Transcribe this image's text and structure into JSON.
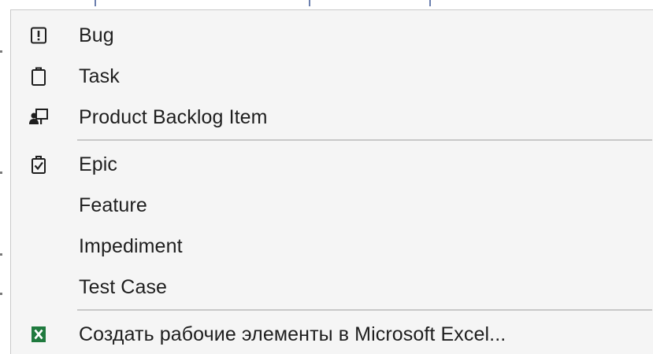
{
  "menu": {
    "items": [
      {
        "label": "Bug",
        "icon": "bug-icon"
      },
      {
        "label": "Task",
        "icon": "task-icon"
      },
      {
        "label": "Product Backlog Item",
        "icon": "backlog-item-icon"
      },
      {
        "label": "Epic",
        "icon": "epic-icon"
      },
      {
        "label": "Feature",
        "icon": ""
      },
      {
        "label": "Impediment",
        "icon": ""
      },
      {
        "label": "Test Case",
        "icon": ""
      },
      {
        "label": "Создать рабочие элементы в Microsoft Excel...",
        "icon": "excel-icon"
      }
    ]
  },
  "colors": {
    "menu_background": "#f5f5f5",
    "separator": "#c8c8c8",
    "text": "#1e1e1e",
    "excel_green": "#1f7a3e"
  }
}
